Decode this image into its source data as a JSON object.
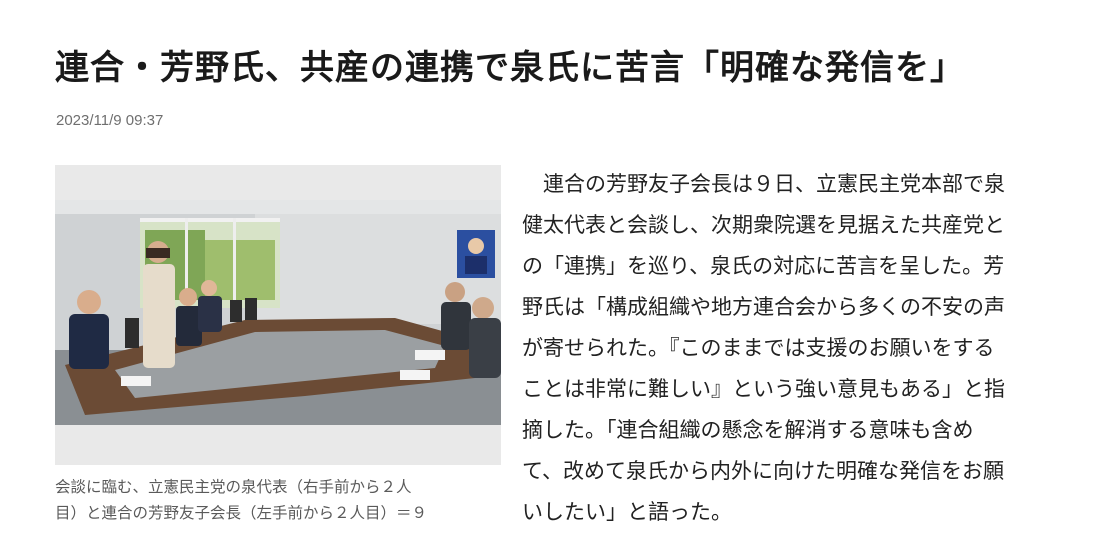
{
  "article": {
    "headline": "連合・芳野氏、共産の連携で泉氏に苦言「明確な発信を」",
    "timestamp": "2023/11/9 09:37",
    "photo_caption": "会談に臨む、立憲民主党の泉代表（右手前から２人\n目）と連合の芳野友子会長（左手前から２人目）＝９",
    "body": "　連合の芳野友子会長は９日、立憲民主党本部で泉\n健太代表と会談し、次期衆院選を見据えた共産党と\nの「連携」を巡り、泉氏の対応に苦言を呈した。芳\n野氏は「構成組織や地方連合会から多くの不安の声\nが寄せられた。『このままでは支援のお願いをする\nことは非常に難しい』という強い意見もある」と指\n摘した。「連合組織の懸念を解消する意味も含め\nて、改めて泉氏から内外に向けた明確な発信をお願\nいしたい」と語った。"
  }
}
